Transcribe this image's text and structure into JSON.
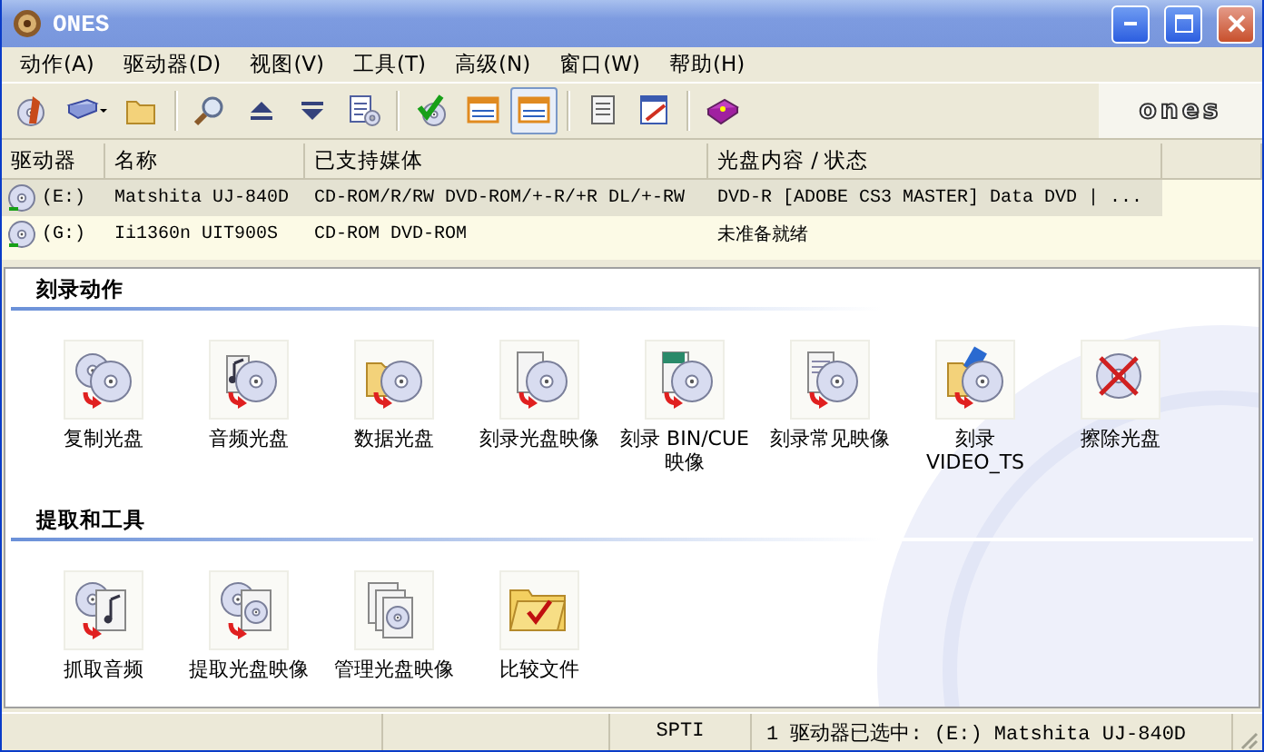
{
  "window": {
    "title": "ONES"
  },
  "menu": [
    "动作(A)",
    "驱动器(D)",
    "视图(V)",
    "工具(T)",
    "高级(N)",
    "窗口(W)",
    "帮助(H)"
  ],
  "toolbar": [
    {
      "selected": false
    },
    {
      "selected": false
    },
    {
      "selected": false
    },
    {
      "selected": false
    },
    {
      "selected": false
    },
    {
      "selected": false
    },
    {
      "selected": false
    },
    {
      "selected": false
    },
    {
      "selected": false
    },
    {
      "selected": true
    },
    {
      "selected": false
    },
    {
      "selected": false
    },
    {
      "selected": false
    }
  ],
  "logo_text": "ones",
  "drives": {
    "columns": [
      "驱动器",
      "名称",
      "已支持媒体",
      "光盘内容 / 状态"
    ],
    "rows": [
      {
        "selected": true,
        "cells": [
          "(E:)",
          "Matshita UJ-840D",
          "CD-ROM/R/RW DVD-ROM/+-R/+R DL/+-RW",
          "DVD-R [ADOBE CS3 MASTER] Data DVD | ..."
        ]
      },
      {
        "selected": false,
        "cells": [
          "(G:)",
          "Ii1360n UIT900S",
          "CD-ROM DVD-ROM",
          "未准备就绪"
        ]
      }
    ]
  },
  "sections": [
    {
      "title": "刻录动作",
      "actions": [
        "复制光盘",
        "音频光盘",
        "数据光盘",
        "刻录光盘映像",
        "刻录 BIN/CUE 映像",
        "刻录常见映像",
        "刻录 VIDEO_TS",
        "擦除光盘"
      ]
    },
    {
      "title": "提取和工具",
      "actions": [
        "抓取音频",
        "提取光盘映像",
        "管理光盘映像",
        "比较文件"
      ]
    }
  ],
  "status_bar": [
    "SPTI",
    "1 驱动器已选中: (E:) Matshita UJ-840D"
  ]
}
